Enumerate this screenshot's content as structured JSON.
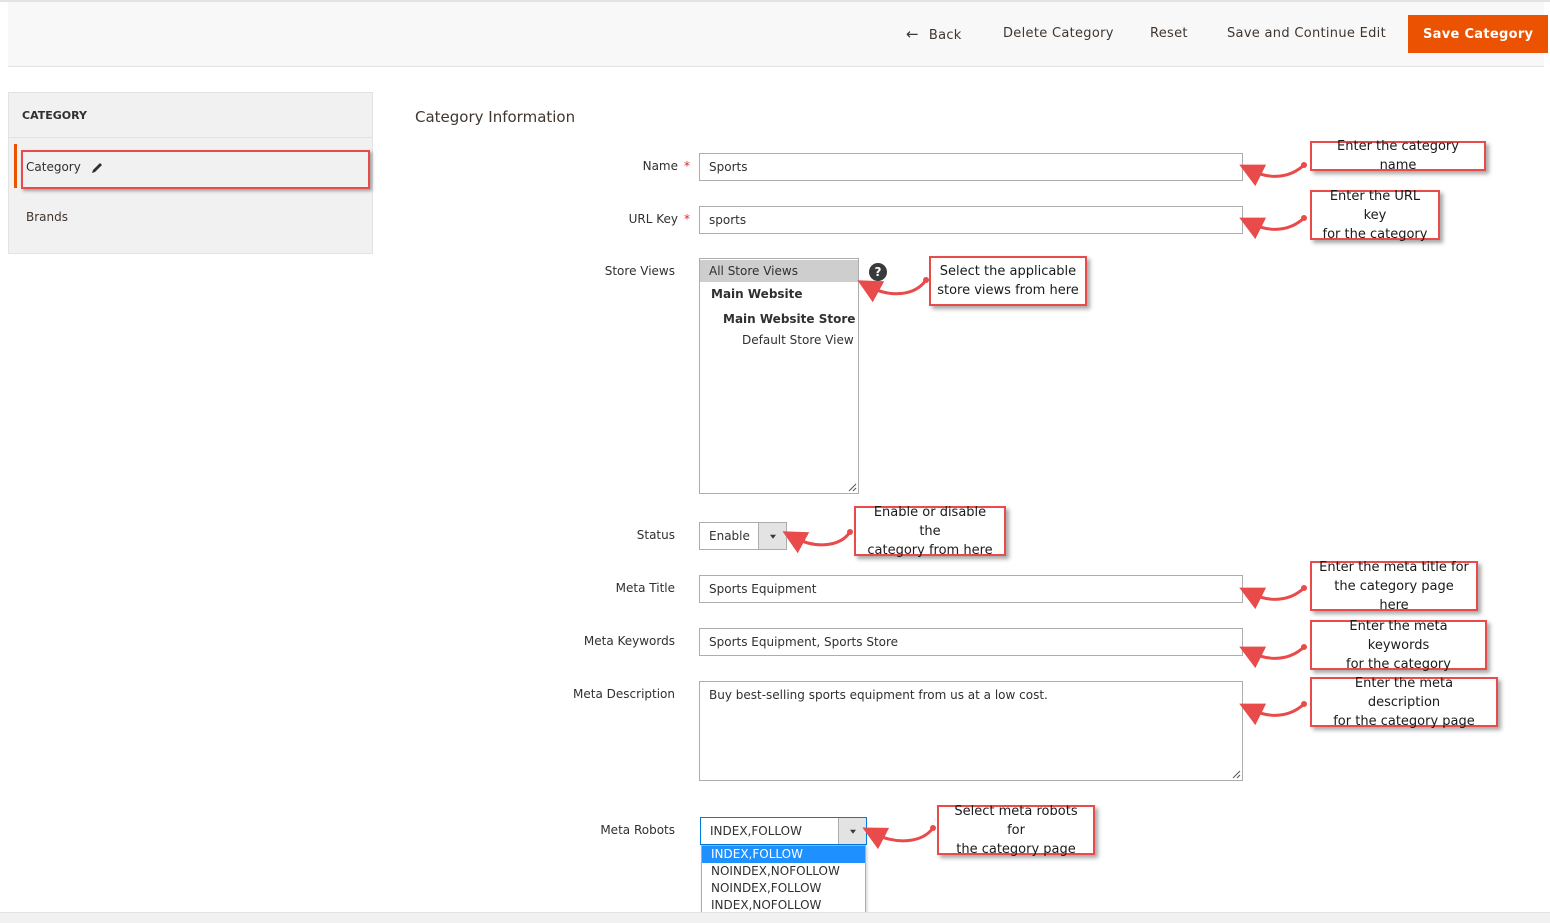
{
  "header": {
    "back_label": "Back",
    "delete_label": "Delete Category",
    "reset_label": "Reset",
    "save_continue_label": "Save and Continue Edit",
    "save_label": "Save Category",
    "accent_color": "#eb5202"
  },
  "sidebar": {
    "title": "CATEGORY",
    "items": [
      {
        "label": "Category",
        "active": true,
        "icon": "pencil-icon"
      },
      {
        "label": "Brands",
        "active": false
      }
    ]
  },
  "section": {
    "title": "Category Information"
  },
  "form": {
    "name": {
      "label": "Name",
      "required_mark": "*",
      "value": "Sports"
    },
    "url_key": {
      "label": "URL Key",
      "required_mark": "*",
      "value": "sports"
    },
    "store_views": {
      "label": "Store Views",
      "options": [
        "All Store Views",
        "Main Website",
        "Main Website Store",
        "Default Store View"
      ],
      "selected": "All Store Views",
      "help_icon": "question-icon",
      "help_text": "?"
    },
    "status": {
      "label": "Status",
      "value": "Enable"
    },
    "meta_title": {
      "label": "Meta Title",
      "value": "Sports Equipment"
    },
    "meta_keywords": {
      "label": "Meta Keywords",
      "value": "Sports Equipment, Sports Store"
    },
    "meta_description": {
      "label": "Meta Description",
      "value": "Buy best-selling sports equipment from us at a low cost."
    },
    "meta_robots": {
      "label": "Meta Robots",
      "value": "INDEX,FOLLOW",
      "options": [
        "INDEX,FOLLOW",
        "NOINDEX,NOFOLLOW",
        "NOINDEX,FOLLOW",
        "INDEX,NOFOLLOW"
      ],
      "highlighted": "INDEX,FOLLOW"
    }
  },
  "annotations": {
    "name": "Enter the category name",
    "url_key": "Enter the URL key\nfor the category",
    "store_views": "Select the applicable\nstore views from here",
    "status": "Enable or disable the\ncategory from here",
    "meta_title": "Enter the meta title for\nthe category page here",
    "meta_keywords": "Enter the meta keywords\nfor the category",
    "meta_description": "Enter the meta description\nfor the category page",
    "meta_robots": "Select meta robots for\nthe category page",
    "color": "#e94a4a"
  }
}
